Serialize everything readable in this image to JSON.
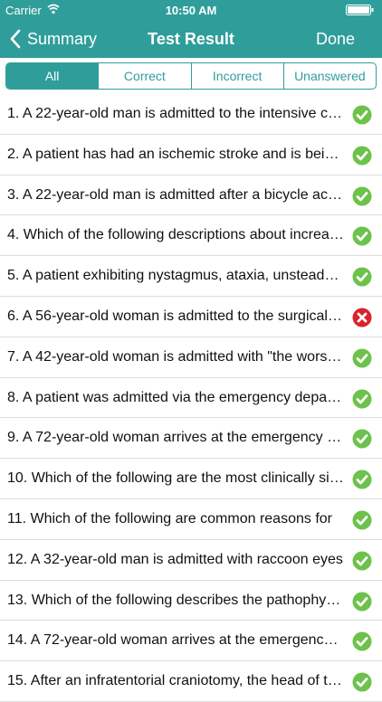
{
  "status_bar": {
    "carrier": "Carrier",
    "time": "10:50 AM"
  },
  "nav": {
    "back_label": "Summary",
    "title": "Test Result",
    "done_label": "Done"
  },
  "tabs": [
    {
      "label": "All",
      "active": true
    },
    {
      "label": "Correct",
      "active": false
    },
    {
      "label": "Incorrect",
      "active": false
    },
    {
      "label": "Unanswered",
      "active": false
    }
  ],
  "colors": {
    "accent": "#2f9e9a",
    "correct": "#6cc24a",
    "incorrect": "#d9232e"
  },
  "results": [
    {
      "text": "1. A 22-year-old man is admitted to the intensive care unit",
      "status": "correct"
    },
    {
      "text": "2. A patient has had an ischemic stroke and is being evaluated",
      "status": "correct"
    },
    {
      "text": "3. A 22-year-old man is admitted after a bicycle accident",
      "status": "correct"
    },
    {
      "text": "4. Which of the following descriptions about increased intracranial pressure",
      "status": "correct"
    },
    {
      "text": "5. A patient exhibiting nystagmus, ataxia, unsteady gait",
      "status": "correct"
    },
    {
      "text": "6. A 56-year-old woman is admitted to the surgical unit",
      "status": "incorrect"
    },
    {
      "text": "7. A 42-year-old woman is admitted with \"the worst headache\"",
      "status": "correct"
    },
    {
      "text": "8. A patient was admitted via the emergency department",
      "status": "correct"
    },
    {
      "text": "9. A 72-year-old woman arrives at the emergency department",
      "status": "correct"
    },
    {
      "text": "10. Which of the following are the most clinically significant",
      "status": "correct"
    },
    {
      "text": "11. Which of the following are common reasons for",
      "status": "correct"
    },
    {
      "text": "12. A 32-year-old man is admitted with raccoon eyes",
      "status": "correct"
    },
    {
      "text": "13. Which of the following describes the pathophysiology",
      "status": "correct"
    },
    {
      "text": "14. A 72-year-old woman arrives at the emergency department",
      "status": "correct"
    },
    {
      "text": "15. After an infratentorial craniotomy, the head of the bed",
      "status": "correct"
    }
  ]
}
